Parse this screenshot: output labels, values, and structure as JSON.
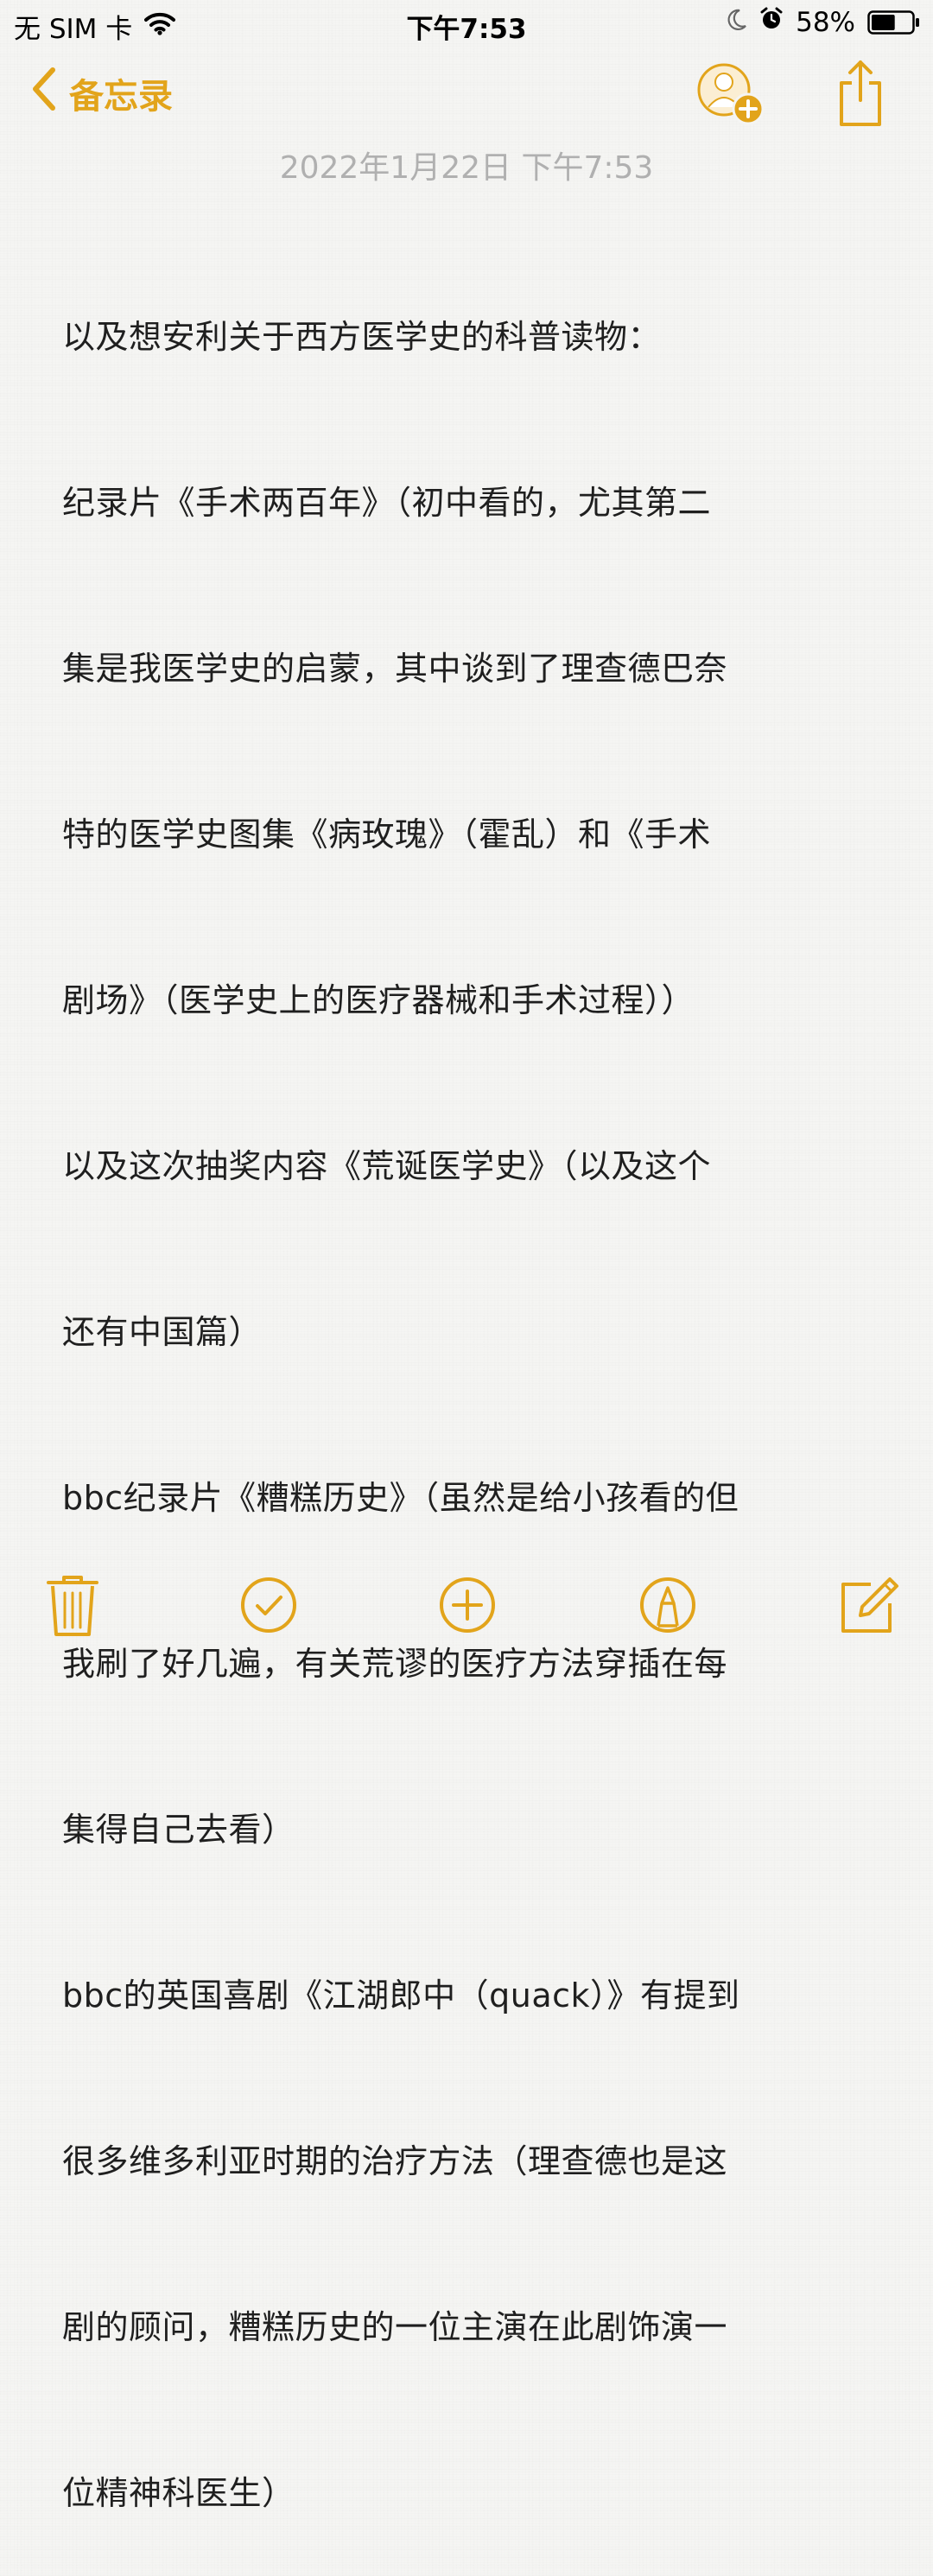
{
  "status_bar": {
    "carrier": "无 SIM 卡",
    "time": "下午7:53",
    "battery_percent": "58%",
    "battery_level": 0.58,
    "icons": [
      "wifi-icon",
      "moon-icon",
      "alarm-icon",
      "battery-icon"
    ]
  },
  "nav": {
    "back_label": "备忘录",
    "accent_color": "#e2a41b",
    "icons": [
      "chevron-left-icon",
      "add-person-icon",
      "share-icon"
    ]
  },
  "note": {
    "date": "2022年1月22日 下午7:53",
    "lines": [
      "以及想安利关于西方医学史的科普读物：",
      "纪录片《手术两百年》（初中看的，尤其第二",
      "集是我医学史的启蒙，其中谈到了理查德巴奈",
      "特的医学史图集《病玫瑰》（霍乱）和《手术",
      "剧场》（医学史上的医疗器械和手术过程））",
      "以及这次抽奖内容《荒诞医学史》（以及这个",
      "还有中国篇）",
      "bbc纪录片《糟糕历史》（虽然是给小孩看的但",
      "我刷了好几遍，有关荒谬的医疗方法穿插在每",
      "集得自己去看）",
      "bbc的英国喜剧《江湖郎中（quack）》有提到",
      "很多维多利亚时期的治疗方法（理查德也是这",
      "剧的顾问，糟糕历史的一位主演在此剧饰演一",
      "位精神科医生）"
    ]
  },
  "toolbar": {
    "icons": [
      "trash-icon",
      "checklist-icon",
      "add-icon",
      "markup-icon",
      "compose-icon"
    ]
  }
}
